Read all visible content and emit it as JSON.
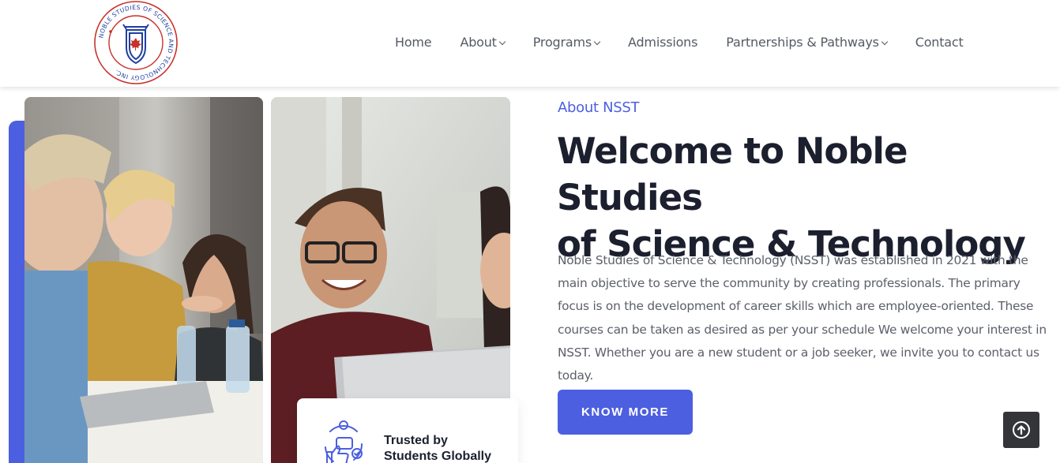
{
  "logo": {
    "ring_text": "NOBLE STUDIES OF SCIENCE AND TECHNOLOGY INC.",
    "colors": {
      "ring": "#c8322c",
      "shield": "#1f3fa0"
    },
    "icon": "shield-crest-maple-leaf-icon"
  },
  "nav": {
    "items": [
      {
        "label": "Home",
        "dropdown": false
      },
      {
        "label": "About",
        "dropdown": true
      },
      {
        "label": "Programs",
        "dropdown": true
      },
      {
        "label": "Admissions",
        "dropdown": false
      },
      {
        "label": "Partnerships & Pathways",
        "dropdown": true
      },
      {
        "label": "Contact",
        "dropdown": false
      }
    ]
  },
  "trust_card": {
    "icon": "thumbs-up-chat-network-icon",
    "line1": "Trusted by",
    "line2": "Students Globally"
  },
  "about": {
    "eyebrow": "About NSST",
    "headline_line1": "Welcome to Noble Studies",
    "headline_line2": "of Science & Technology",
    "paragraph": "Noble Studies of Science & Technology (NSST) was established in 2021 with the main objective to serve the community by creating professionals. The primary focus is on the development of career skills which are employee-oriented. These courses can be taken as desired as per your schedule We welcome your interest in NSST. Whether you are a new student or a job seeker, we invite you to contact us today.",
    "cta_label": "KNOW MORE"
  },
  "scroll_top": {
    "icon": "arrow-up-circle-icon"
  },
  "colors": {
    "accent": "#4c5fe0",
    "heading": "#1b1f2e",
    "body_text": "#5c606a",
    "scroll_button": "#333539"
  }
}
